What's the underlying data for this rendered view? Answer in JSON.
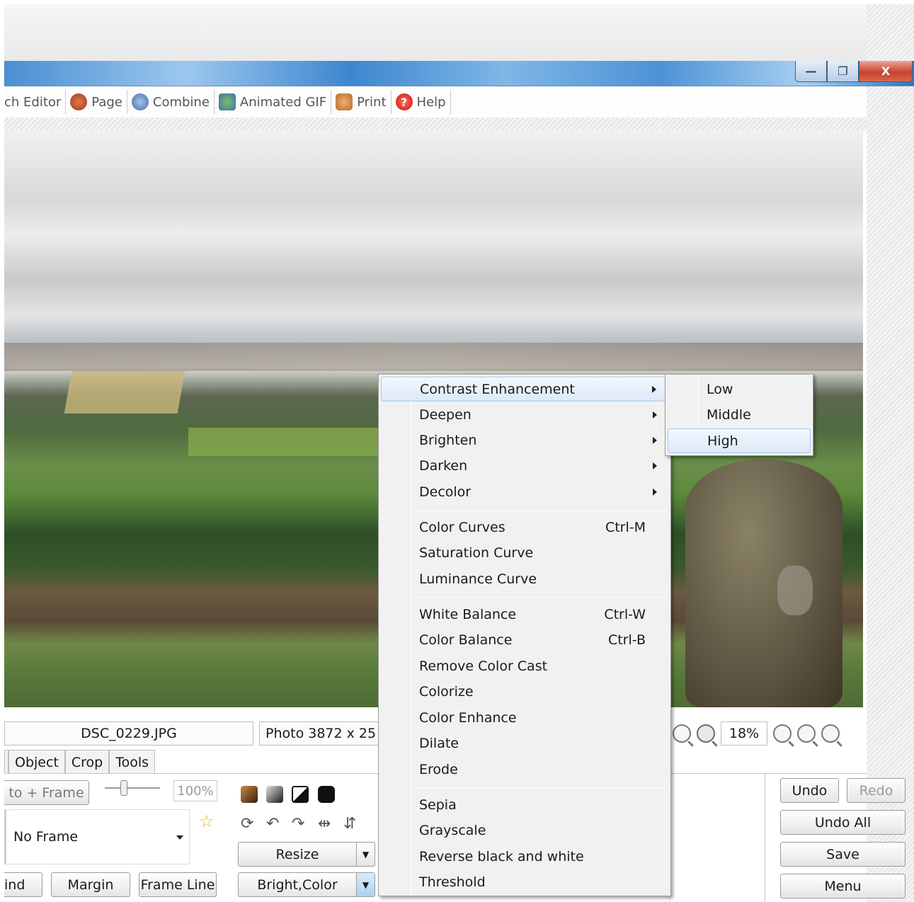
{
  "window": {
    "min_label": "—",
    "max_label": "❐",
    "close_label": "X"
  },
  "tabs": [
    {
      "label": "ch Editor",
      "icon": "batch-editor-icon"
    },
    {
      "label": "Page",
      "icon": "page-icon"
    },
    {
      "label": "Combine",
      "icon": "combine-icon"
    },
    {
      "label": "Animated GIF",
      "icon": "animated-gif-icon"
    },
    {
      "label": "Print",
      "icon": "print-icon"
    },
    {
      "label": "Help",
      "icon": "help-icon"
    }
  ],
  "status": {
    "filename": "DSC_0229.JPG",
    "photo_info": "Photo 3872 x 25",
    "zoom": "18%"
  },
  "panel_tabs": [
    "Object",
    "Crop",
    "Tools"
  ],
  "left_panel": {
    "photo_frame_btn": "to + Frame",
    "opacity_pct": "100%",
    "frame_select": "No Frame",
    "btn_ind": "ind",
    "btn_margin": "Margin",
    "btn_frame_line": "Frame Line"
  },
  "mid_panel": {
    "resize": "Resize",
    "bright_color": "Bright,Color"
  },
  "right_panel": {
    "undo": "Undo",
    "redo": "Redo",
    "undo_all": "Undo All",
    "save": "Save",
    "menu": "Menu"
  },
  "menu": {
    "group1": [
      {
        "label": "Contrast Enhancement",
        "submenu": true,
        "highlighted": true
      },
      {
        "label": "Deepen",
        "submenu": true
      },
      {
        "label": "Brighten",
        "submenu": true
      },
      {
        "label": "Darken",
        "submenu": true
      },
      {
        "label": "Decolor",
        "submenu": true
      }
    ],
    "group2": [
      {
        "label": "Color Curves",
        "shortcut": "Ctrl-M"
      },
      {
        "label": "Saturation Curve",
        "shortcut": ""
      },
      {
        "label": "Luminance Curve",
        "shortcut": ""
      }
    ],
    "group3": [
      {
        "label": "White Balance",
        "shortcut": "Ctrl-W"
      },
      {
        "label": "Color Balance",
        "shortcut": "Ctrl-B"
      },
      {
        "label": "Remove Color Cast",
        "shortcut": ""
      },
      {
        "label": "Colorize",
        "shortcut": ""
      },
      {
        "label": "Color Enhance",
        "shortcut": ""
      },
      {
        "label": "Dilate",
        "shortcut": ""
      },
      {
        "label": "Erode",
        "shortcut": ""
      }
    ],
    "group4": [
      {
        "label": "Sepia"
      },
      {
        "label": "Grayscale"
      },
      {
        "label": "Reverse black and white"
      },
      {
        "label": "Threshold"
      }
    ]
  },
  "submenu": [
    {
      "label": "Low"
    },
    {
      "label": "Middle"
    },
    {
      "label": "High",
      "highlighted": true
    }
  ],
  "colors": {
    "titlebar": "#4a8ed2",
    "menu_bg": "#f1f1f1",
    "highlight": "#dde9f7",
    "close": "#c7432c"
  }
}
